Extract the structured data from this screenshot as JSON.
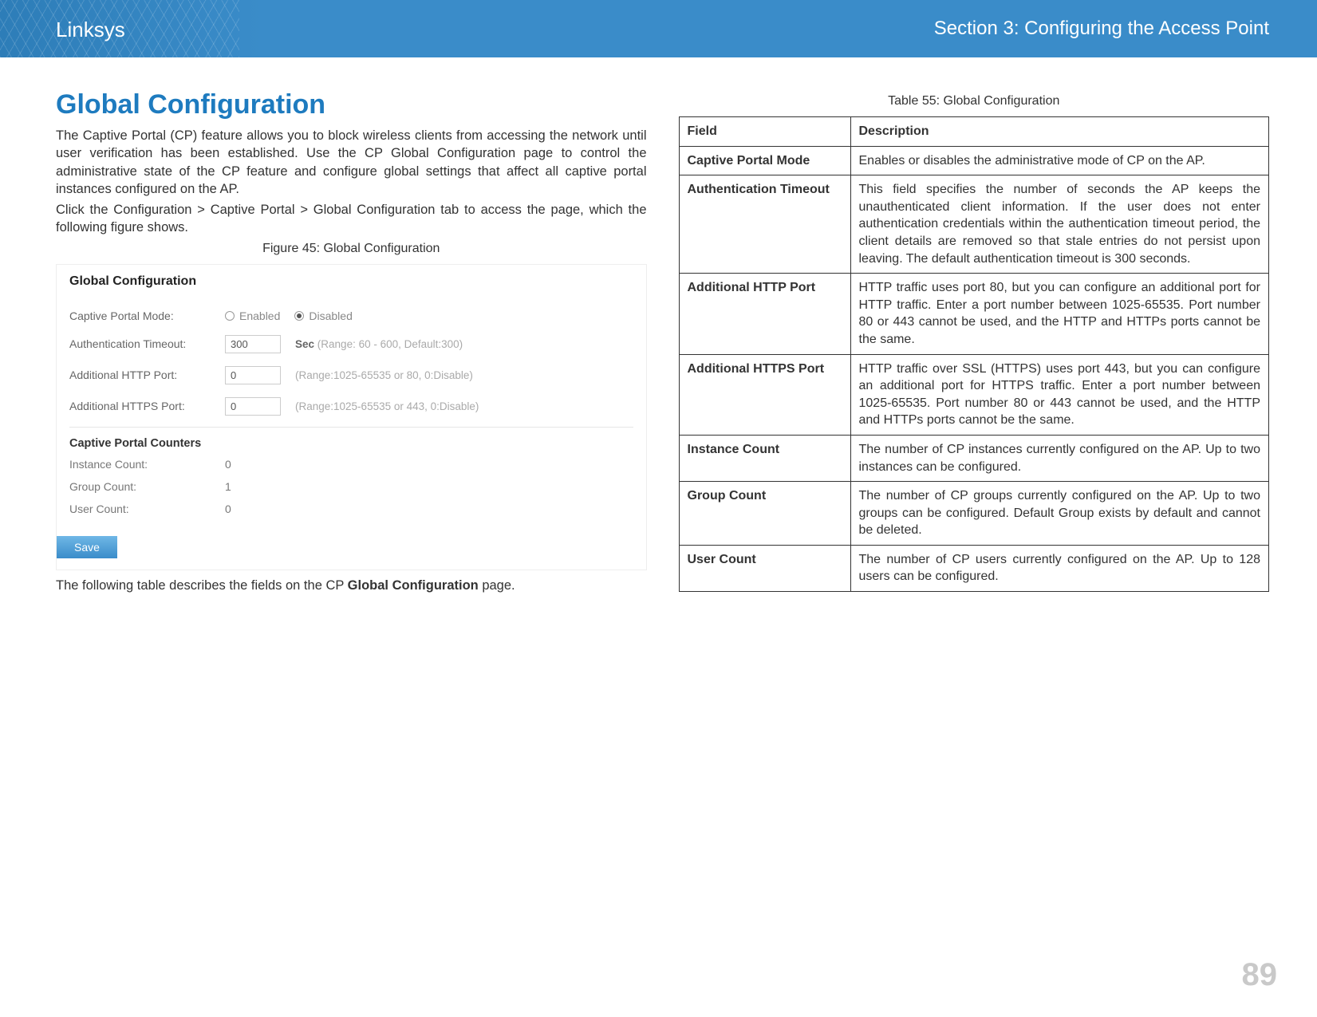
{
  "header": {
    "brand": "Linksys",
    "section": "Section 3:  Configuring the Access Point"
  },
  "left": {
    "title": "Global Configuration",
    "para1": "The Captive Portal (CP) feature allows you to block wireless clients from accessing the network until user verification has been established. Use the CP Global Configuration page to control the administrative state of the CP feature and configure global settings that affect all captive portal instances configured on the AP.",
    "para2": "Click the Configuration > Captive Portal > Global Configuration tab to access the page, which the following figure shows.",
    "figure_caption": "Figure 45: Global Configuration",
    "after_figure_a": "The following table describes the fields on the CP ",
    "after_figure_bold": "Global Configuration",
    "after_figure_b": " page."
  },
  "screenshot": {
    "heading": "Global Configuration",
    "rows": {
      "mode_label": "Captive Portal Mode:",
      "enabled": "Enabled",
      "disabled": "Disabled",
      "auth_label": "Authentication Timeout:",
      "auth_val": "300",
      "auth_unit": "Sec",
      "auth_hint": "(Range: 60 - 600, Default:300)",
      "http_label": "Additional HTTP Port:",
      "http_val": "0",
      "http_hint": "(Range:1025-65535 or 80, 0:Disable)",
      "https_label": "Additional HTTPS Port:",
      "https_val": "0",
      "https_hint": "(Range:1025-65535 or 443, 0:Disable)"
    },
    "counters": {
      "title": "Captive Portal Counters",
      "instance_label": "Instance Count:",
      "instance_val": "0",
      "group_label": "Group Count:",
      "group_val": "1",
      "user_label": "User Count:",
      "user_val": "0"
    },
    "save": "Save"
  },
  "right": {
    "caption": "Table 55: Global Configuration",
    "head_field": "Field",
    "head_desc": "Description",
    "rows": [
      {
        "field": "Captive Portal Mode",
        "desc": "Enables or disables the administrative mode of CP on the AP."
      },
      {
        "field": "Authentication Timeout",
        "desc": "This field specifies the number of seconds the AP keeps the unauthenticated client information. If the user does not enter authentication credentials within the authentication timeout period, the client details are removed so that stale entries do not persist upon leaving. The default authentication timeout is 300 seconds."
      },
      {
        "field": "Additional HTTP Port",
        "desc": "HTTP traffic uses port 80, but you can configure an additional port for HTTP traffic. Enter a port number between 1025-65535. Port number 80 or 443 cannot be used, and the HTTP and HTTPs ports cannot be the same."
      },
      {
        "field": "Additional HTTPS Port",
        "desc": "HTTP traffic over SSL (HTTPS) uses port 443, but you can configure an additional port for HTTPS traffic. Enter a port number between 1025-65535. Port number 80 or 443 cannot be used, and the HTTP and HTTPs ports cannot be the same."
      },
      {
        "field": "Instance Count",
        "desc": "The number of CP instances currently configured on the AP. Up to two instances can be configured."
      },
      {
        "field": "Group Count",
        "desc": "The number of CP groups currently configured on the AP. Up to two groups can be configured. Default Group exists by default and cannot be deleted."
      },
      {
        "field": "User Count",
        "desc": "The number of CP users currently configured on the AP. Up to 128 users can be configured."
      }
    ]
  },
  "page_number": "89"
}
